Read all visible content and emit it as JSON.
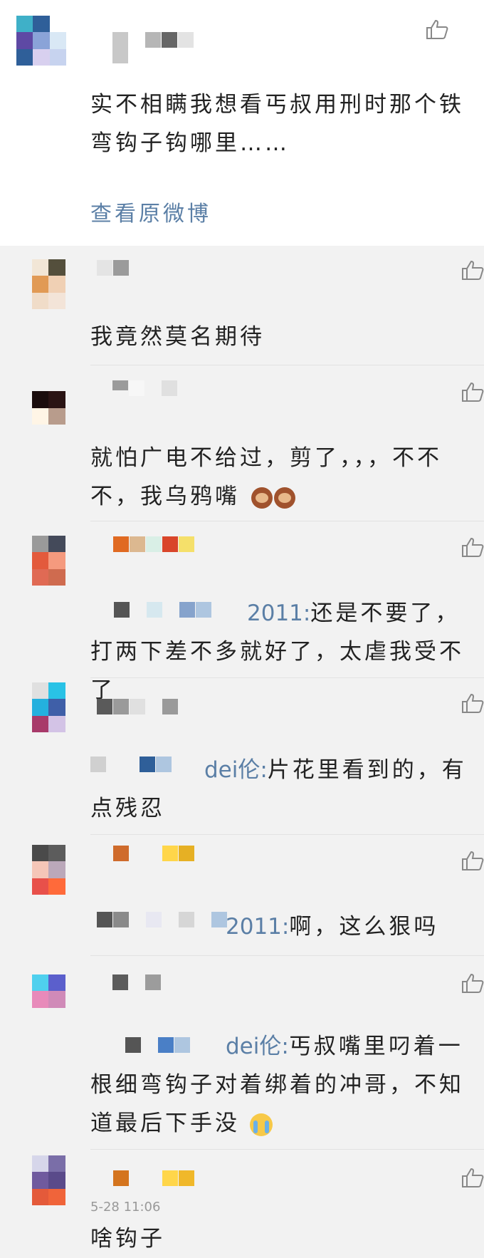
{
  "comments": [
    {
      "text": "实不相瞒我想看丐叔用刑时那个铁弯钩子钩哪里……",
      "link": "查看原微博"
    },
    {
      "text": "我竟然莫名期待"
    },
    {
      "text": "就怕广电不给过，剪了，，，不不不，我乌鸦嘴"
    },
    {
      "mention": "2011:",
      "text": "还是不要了，打两下差不多就好了，太虐我受不了"
    },
    {
      "mention": "dei伦:",
      "text": "片花里看到的，有点残忍"
    },
    {
      "mention": "2011:",
      "text": "啊，这么狠吗"
    },
    {
      "mention": "dei伦:",
      "text": "丐叔嘴里叼着一根细弯钩子对着绑着的冲哥，不知道最后下手没"
    },
    {
      "timestamp": "5-28 11:06",
      "text": "啥钩子"
    }
  ],
  "icons": {
    "like": "thumbs-up-icon",
    "emoji_monkey": "see-no-evil-monkey-icon",
    "emoji_cry": "loudly-crying-face-icon"
  },
  "colors": {
    "link": "#5b7fa6",
    "background": "#f2f2f2",
    "card": "#ffffff"
  }
}
